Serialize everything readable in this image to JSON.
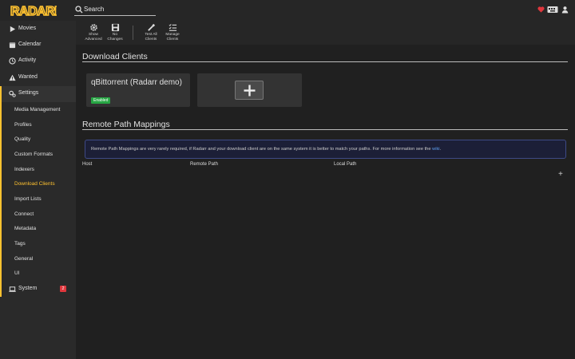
{
  "app": {
    "logo_text": "RADARR"
  },
  "header": {
    "search_placeholder": "Search",
    "icons": [
      "heart-icon",
      "keyboard-icon",
      "user-icon"
    ]
  },
  "sidebar": {
    "items": [
      {
        "label": "Movies",
        "icon": "play-icon"
      },
      {
        "label": "Calendar",
        "icon": "calendar-icon"
      },
      {
        "label": "Activity",
        "icon": "clock-icon"
      },
      {
        "label": "Wanted",
        "icon": "warning-icon"
      },
      {
        "label": "Settings",
        "icon": "cogs-icon"
      }
    ],
    "settings_sub": [
      "Media Management",
      "Profiles",
      "Quality",
      "Custom Formats",
      "Indexers",
      "Download Clients",
      "Import Lists",
      "Connect",
      "Metadata",
      "Tags",
      "General",
      "UI"
    ],
    "system": {
      "label": "System",
      "icon": "laptop-icon",
      "badge": "2"
    },
    "current": "Download Clients"
  },
  "toolbar": {
    "buttons": [
      {
        "line1": "Show",
        "line2": "Advanced",
        "icon": "cog-icon"
      },
      {
        "line1": "No",
        "line2": "Changes",
        "icon": "save-icon"
      },
      {
        "line1": "Test All",
        "line2": "Clients",
        "icon": "test-icon"
      },
      {
        "line1": "Manage",
        "line2": "Clients",
        "icon": "list-check-icon"
      }
    ]
  },
  "main": {
    "download_clients_title": "Download Clients",
    "client": {
      "name": "qBittorrent (Radarr demo)",
      "status": "Enabled"
    },
    "remote_path_title": "Remote Path Mappings",
    "alert_text": "Remote Path Mappings are very rarely required, if Radarr and your download client are on the same system it is better to match your paths. For more information see the",
    "alert_link": "wiki",
    "alert_end": ".",
    "columns": [
      "Host",
      "Remote Path",
      "Local Path"
    ],
    "add_symbol": "+"
  },
  "colors": {
    "accent": "#ffc230",
    "enabled": "#27a644",
    "badge": "#e0373d",
    "link": "#5d9cec"
  }
}
